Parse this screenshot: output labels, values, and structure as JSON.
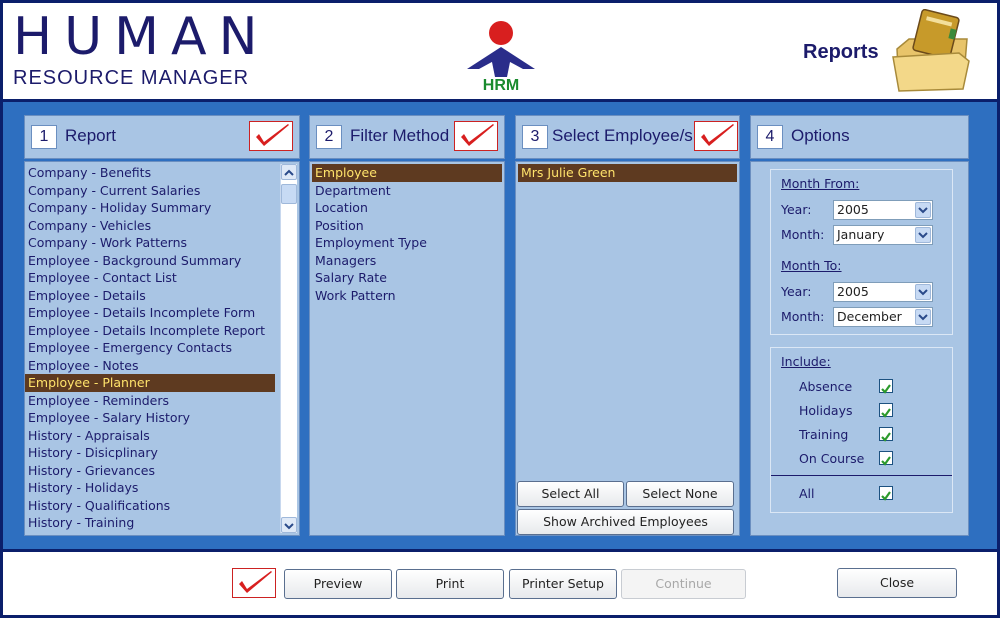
{
  "header": {
    "logo_main": "HUMAN",
    "logo_sub": "RESOURCE MANAGER",
    "center_logo_text": "HRM",
    "title": "Reports",
    "folder_icon": "reports-folder-icon"
  },
  "panels": [
    {
      "num": "1",
      "title": "Report"
    },
    {
      "num": "2",
      "title": "Filter Method"
    },
    {
      "num": "3",
      "title": "Select Employee/s"
    },
    {
      "num": "4",
      "title": "Options"
    }
  ],
  "reports": [
    {
      "label": "Company - Benefits",
      "selected": false
    },
    {
      "label": "Company - Current Salaries",
      "selected": false
    },
    {
      "label": "Company - Holiday Summary",
      "selected": false
    },
    {
      "label": "Company - Vehicles",
      "selected": false
    },
    {
      "label": "Company - Work Patterns",
      "selected": false
    },
    {
      "label": "Employee - Background Summary",
      "selected": false
    },
    {
      "label": "Employee - Contact List",
      "selected": false
    },
    {
      "label": "Employee - Details",
      "selected": false
    },
    {
      "label": "Employee - Details Incomplete Form",
      "selected": false
    },
    {
      "label": "Employee - Details Incomplete Report",
      "selected": false
    },
    {
      "label": "Employee - Emergency Contacts",
      "selected": false
    },
    {
      "label": "Employee - Notes",
      "selected": false
    },
    {
      "label": "Employee - Planner",
      "selected": true
    },
    {
      "label": "Employee - Reminders",
      "selected": false
    },
    {
      "label": "Employee - Salary History",
      "selected": false
    },
    {
      "label": "History - Appraisals",
      "selected": false
    },
    {
      "label": "History - Disicplinary",
      "selected": false
    },
    {
      "label": "History - Grievances",
      "selected": false
    },
    {
      "label": "History - Holidays",
      "selected": false
    },
    {
      "label": "History - Qualifications",
      "selected": false
    },
    {
      "label": "History - Training",
      "selected": false
    }
  ],
  "filters": [
    {
      "label": "Employee",
      "selected": true
    },
    {
      "label": "Department",
      "selected": false
    },
    {
      "label": "Location",
      "selected": false
    },
    {
      "label": "Position",
      "selected": false
    },
    {
      "label": "Employment Type",
      "selected": false
    },
    {
      "label": "Managers",
      "selected": false
    },
    {
      "label": "Salary Rate",
      "selected": false
    },
    {
      "label": "Work Pattern",
      "selected": false
    }
  ],
  "employees": [
    {
      "label": "Mrs Julie Green",
      "selected": true
    }
  ],
  "employee_buttons": {
    "select_all": "Select All",
    "select_none": "Select None",
    "show_archived": "Show Archived Employees"
  },
  "options": {
    "month_from_label": "Month From:",
    "month_to_label": "Month To:",
    "year_label": "Year:",
    "month_label": "Month:",
    "from_year": "2005",
    "from_month": "January",
    "to_year": "2005",
    "to_month": "December",
    "include_label": "Include:",
    "include_items": [
      {
        "label": "Absence",
        "checked": true
      },
      {
        "label": "Holidays",
        "checked": true
      },
      {
        "label": "Training",
        "checked": true
      },
      {
        "label": "On Course",
        "checked": true
      }
    ],
    "all_label": "All",
    "all_checked": true
  },
  "footer": {
    "preview": "Preview",
    "print": "Print",
    "printer_setup": "Printer Setup",
    "continue": "Continue",
    "close": "Close"
  },
  "colors": {
    "navy": "#1c1b6b",
    "panel_bg": "#a9c5e4",
    "main_bg": "#2e6fc0",
    "selection_bg": "#5e3a20",
    "selection_text": "#ffe36b",
    "check_red": "#d81f1f",
    "check_green": "#2c9a2c"
  }
}
